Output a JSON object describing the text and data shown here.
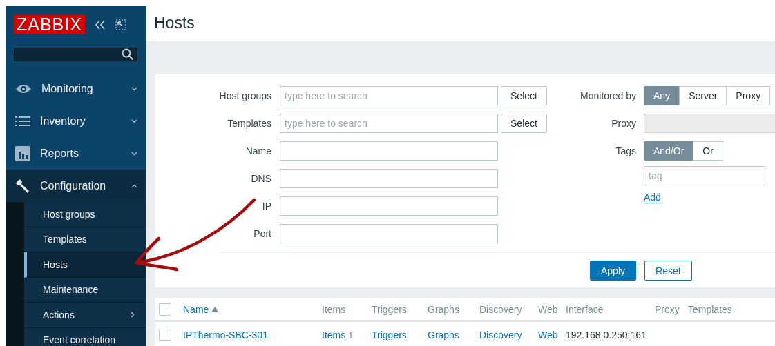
{
  "sidebar": {
    "logo": "ZABBIX",
    "menu": [
      {
        "label": "Monitoring",
        "expanded": false
      },
      {
        "label": "Inventory",
        "expanded": false
      },
      {
        "label": "Reports",
        "expanded": false
      },
      {
        "label": "Configuration",
        "expanded": true,
        "children": [
          {
            "label": "Host groups",
            "selected": false,
            "submenu": false
          },
          {
            "label": "Templates",
            "selected": false,
            "submenu": false
          },
          {
            "label": "Hosts",
            "selected": true,
            "submenu": false
          },
          {
            "label": "Maintenance",
            "selected": false,
            "submenu": false
          },
          {
            "label": "Actions",
            "selected": false,
            "submenu": true
          },
          {
            "label": "Event correlation",
            "selected": false,
            "submenu": false
          }
        ]
      }
    ]
  },
  "page": {
    "title": "Hosts"
  },
  "filter": {
    "fields": [
      {
        "label": "Host groups",
        "kind": "multiselect",
        "placeholder": "type here to search",
        "button": "Select"
      },
      {
        "label": "Templates",
        "kind": "multiselect",
        "placeholder": "type here to search",
        "button": "Select"
      },
      {
        "label": "Name",
        "kind": "text"
      },
      {
        "label": "DNS",
        "kind": "text"
      },
      {
        "label": "IP",
        "kind": "text"
      },
      {
        "label": "Port",
        "kind": "text"
      }
    ],
    "monitored_by": {
      "label": "Monitored by",
      "options": [
        {
          "label": "Any",
          "selected": true
        },
        {
          "label": "Server",
          "selected": false
        },
        {
          "label": "Proxy",
          "selected": false
        }
      ]
    },
    "proxy": {
      "label": "Proxy",
      "disabled": true
    },
    "tags": {
      "label": "Tags",
      "options": [
        {
          "label": "And/Or",
          "selected": true
        },
        {
          "label": "Or",
          "selected": false
        }
      ],
      "placeholder": "tag",
      "add": "Add"
    },
    "buttons": [
      {
        "label": "Apply",
        "kind": "primary"
      },
      {
        "label": "Reset",
        "kind": "secondary"
      }
    ]
  },
  "table": {
    "select_all_checked": false,
    "columns": [
      {
        "label": "Name",
        "sorted": true,
        "link": true
      },
      {
        "label": "Items",
        "sorted": false,
        "link": false
      },
      {
        "label": "Triggers",
        "sorted": false,
        "link": false
      },
      {
        "label": "Graphs",
        "sorted": false,
        "link": false
      },
      {
        "label": "Discovery",
        "sorted": false,
        "link": false
      },
      {
        "label": "Web",
        "sorted": false,
        "link": false
      },
      {
        "label": "Interface",
        "sorted": false,
        "link": false
      },
      {
        "label": "Proxy",
        "sorted": false,
        "link": false
      },
      {
        "label": "Templates",
        "sorted": false,
        "link": false
      }
    ],
    "rows": [
      {
        "checked": false,
        "name": "IPThermo-SBC-301",
        "items": "Items",
        "items_count": "1",
        "triggers": "Triggers",
        "graphs": "Graphs",
        "discovery": "Discovery",
        "web": "Web",
        "interface": "192.168.0.250:161"
      }
    ]
  }
}
